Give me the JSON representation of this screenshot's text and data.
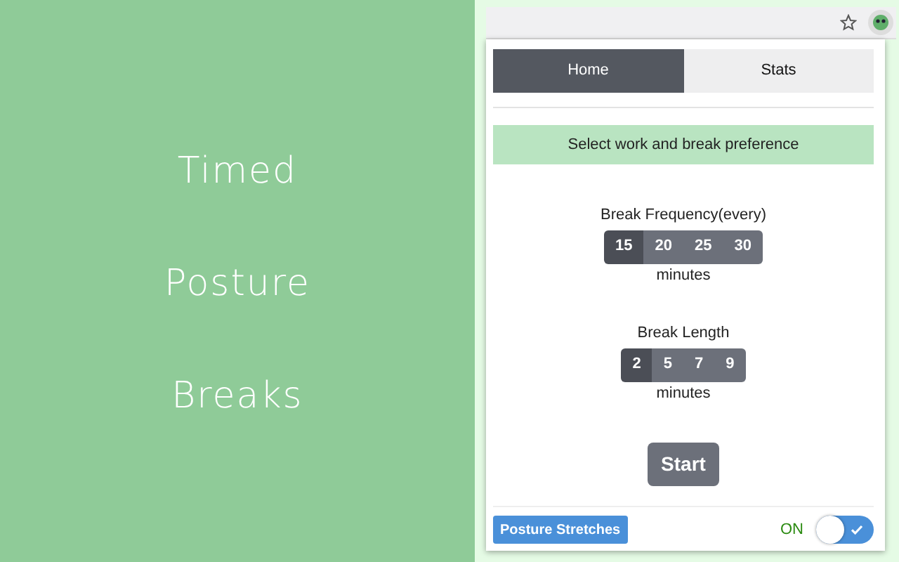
{
  "promo": {
    "lines": [
      "Timed",
      "Posture",
      "Breaks"
    ]
  },
  "tabs": [
    {
      "label": "Home",
      "selected": true
    },
    {
      "label": "Stats",
      "selected": false
    }
  ],
  "banner": "Select work and break preference",
  "groups": [
    {
      "label": "Break Frequency(every)",
      "unit": "minutes",
      "options": [
        {
          "label": "15",
          "selected": true
        },
        {
          "label": "20",
          "selected": false
        },
        {
          "label": "25",
          "selected": false
        },
        {
          "label": "30",
          "selected": false
        }
      ]
    },
    {
      "label": "Break Length",
      "unit": "minutes",
      "options": [
        {
          "label": "2",
          "selected": true
        },
        {
          "label": "5",
          "selected": false
        },
        {
          "label": "7",
          "selected": false
        },
        {
          "label": "9",
          "selected": false
        }
      ]
    }
  ],
  "start_button": "Start",
  "stretches_button": "Posture Stretches",
  "toggle": {
    "label": "ON",
    "on": true
  }
}
